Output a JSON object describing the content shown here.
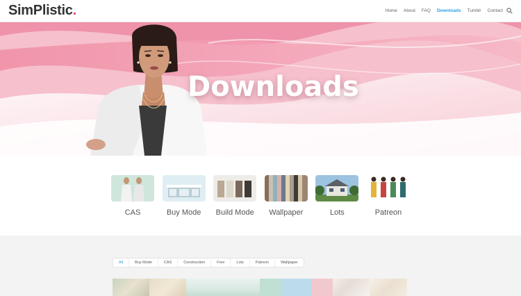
{
  "header": {
    "logo_text": "SimPlistic",
    "logo_dot": ".",
    "nav": [
      "Home",
      "About",
      "FAQ",
      "Downloads",
      "Tumblr",
      "Contact"
    ],
    "active_nav": "Downloads"
  },
  "hero": {
    "title": "Downloads"
  },
  "categories": [
    {
      "label": "CAS",
      "icon": "cas-thumbnail"
    },
    {
      "label": "Buy Mode",
      "icon": "buy-mode-thumbnail"
    },
    {
      "label": "Build Mode",
      "icon": "build-mode-thumbnail"
    },
    {
      "label": "Wallpaper",
      "icon": "wallpaper-thumbnail"
    },
    {
      "label": "Lots",
      "icon": "lots-thumbnail"
    },
    {
      "label": "Patreon",
      "icon": "patreon-thumbnail"
    }
  ],
  "filters": [
    "All",
    "Buy Mode",
    "CAS",
    "Construction",
    "Free",
    "Lots",
    "Patreon",
    "Wallpaper"
  ],
  "active_filter": "All",
  "colors": {
    "accent": "#2e9fe6",
    "brand_dot": "#e5407a",
    "hero_pink": "#f7c3cf"
  }
}
